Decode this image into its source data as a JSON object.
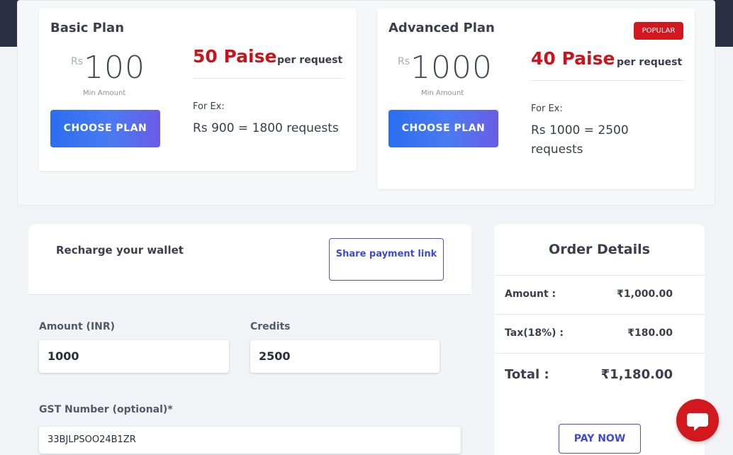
{
  "plans": [
    {
      "title": "Basic Plan",
      "currency": "Rs",
      "min_amount": "100",
      "min_label": "Min Amount",
      "button": "CHOOSE PLAN",
      "rate": "50 Paise",
      "per": "per request",
      "forex_label": "For Ex:",
      "example": "Rs 900 = 1800 requests",
      "badge": ""
    },
    {
      "title": "Advanced Plan",
      "currency": "Rs",
      "min_amount": "1000",
      "min_label": "Min Amount",
      "button": "CHOOSE PLAN",
      "rate": "40 Paise",
      "per": "per request",
      "forex_label": "For Ex:",
      "example": "Rs 1000 = 2500 requests",
      "badge": "POPULAR"
    }
  ],
  "wallet": {
    "title": "Recharge your wallet",
    "share_button": "Share payment link",
    "amount_label": "Amount (INR)",
    "amount_value": "1000",
    "credits_label": "Credits",
    "credits_value": "2500",
    "gst_label": "GST Number (optional)*",
    "gst_value": "33BJLPSOO24B1ZR"
  },
  "order": {
    "title": "Order Details",
    "rows": [
      {
        "label": "Amount :",
        "value": "₹1,000.00"
      },
      {
        "label": "Tax(18%) :",
        "value": "₹180.00"
      },
      {
        "label": "Total :",
        "value": "₹1,180.00"
      }
    ],
    "pay_button": "PAY NOW"
  },
  "colors": {
    "accent_red": "#d1181f",
    "accent_blue": "#3f4bcf",
    "topbar": "#2a2f43"
  },
  "icons": {
    "chat": "chat-bubble-icon"
  }
}
